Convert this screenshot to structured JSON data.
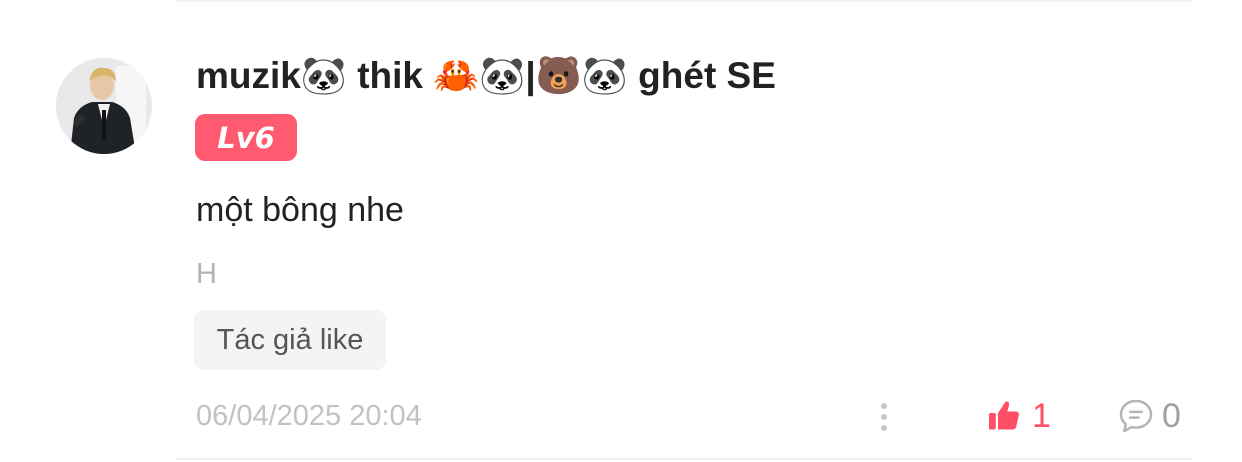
{
  "comment": {
    "username": "muzik🐼 thik 🦀🐼|🐻🐼 ghét SE",
    "level": "Lv6",
    "text": "một bông nhe",
    "sub_text": "H",
    "author_like_label": "Tác giả like",
    "timestamp": "06/04/2025 20:04",
    "like_count": "1",
    "reply_count": "0"
  },
  "colors": {
    "level_badge": "#ff5a70",
    "like_accent": "#ff4f66",
    "muted": "#c2c2c2"
  },
  "icons": {
    "more": "more-vertical-icon",
    "like": "thumbs-up-icon",
    "reply": "comment-bubble-icon"
  }
}
